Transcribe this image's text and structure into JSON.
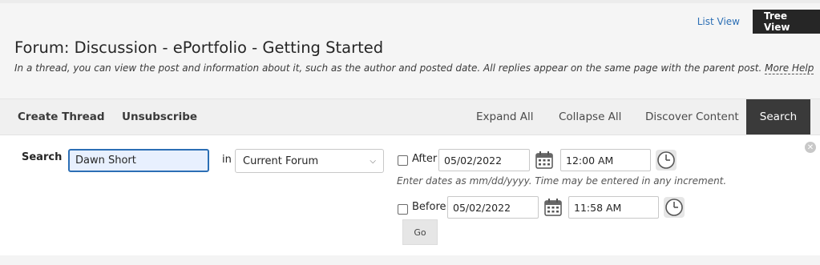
{
  "header": {
    "list_view_label": "List View",
    "tree_view_label": "Tree View",
    "title": "Forum: Discussion - ePortfolio - Getting Started",
    "description": "In a thread, you can view the post and information about it, such as the author and posted date. All replies appear on the same page with the parent post.",
    "more_help_label": "More Help"
  },
  "toolbar": {
    "create_thread_label": "Create Thread",
    "unsubscribe_label": "Unsubscribe",
    "expand_all_label": "Expand All",
    "collapse_all_label": "Collapse All",
    "discover_content_label": "Discover Content",
    "search_label": "Search"
  },
  "search": {
    "label": "Search",
    "query_value": "Dawn Short",
    "in_label": "in",
    "scope_selected": "Current Forum",
    "after": {
      "label": "After",
      "checked": false,
      "date": "05/02/2022",
      "time": "12:00 AM"
    },
    "hint": "Enter dates as mm/dd/yyyy. Time may be entered in any increment.",
    "before": {
      "label": "Before",
      "checked": false,
      "date": "05/02/2022",
      "time": "11:58 AM"
    },
    "go_label": "Go"
  },
  "icons": {
    "calendar": "calendar-icon",
    "clock": "clock-icon",
    "close": "close-icon",
    "dropdown": "chevron-down-icon"
  },
  "colors": {
    "accent": "#2c6fb5",
    "active_tab": "#3a3a3a",
    "tree_view_bg": "#262626"
  }
}
